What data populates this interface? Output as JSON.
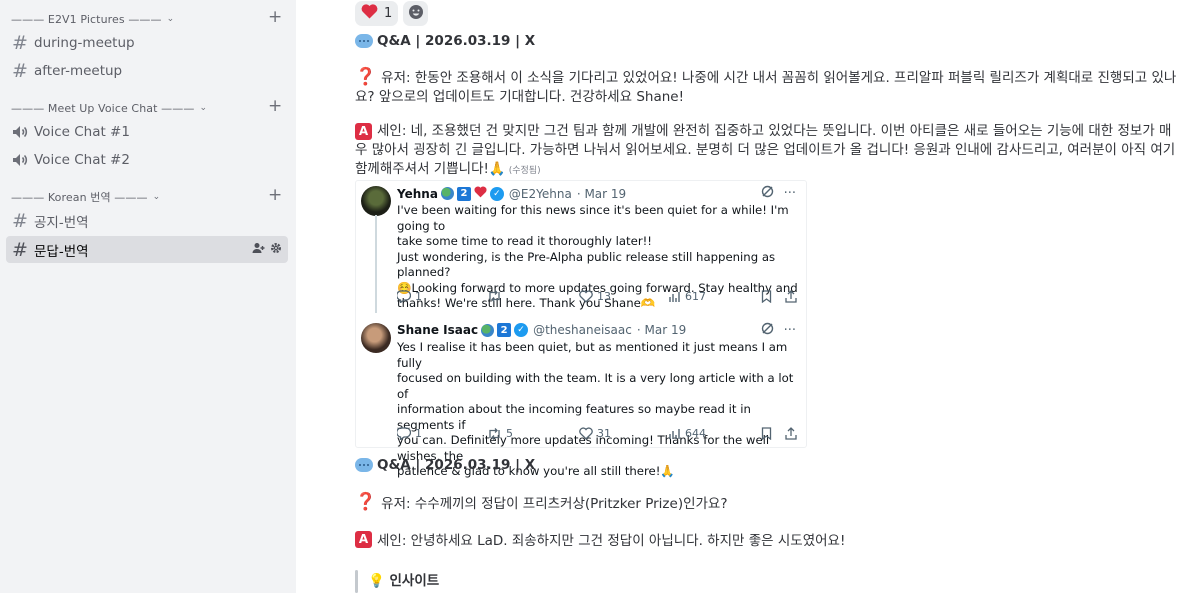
{
  "sidebar": {
    "categories": [
      {
        "label": "——— E2V1 Pictures ———"
      },
      {
        "label": "——— Meet Up Voice Chat ———"
      },
      {
        "label": "——— Korean 번역 ———"
      }
    ],
    "channels": [
      {
        "label": "during-meetup"
      },
      {
        "label": "after-meetup"
      },
      {
        "label": "Voice Chat #1"
      },
      {
        "label": "Voice Chat #2"
      },
      {
        "label": "공지-번역"
      },
      {
        "label": "문답-번역"
      }
    ]
  },
  "reactions": [
    {
      "emoji": "❤️",
      "count": "1"
    }
  ],
  "messages": [
    {
      "header": "Q&A | 2026.03.19 | X",
      "question": "유저: 한동안 조용해서 이 소식을 기다리고 있었어요! 나중에 시간 내서 꼼꼼히 읽어볼게요. 프리알파 퍼블릭 릴리즈가 계획대로 진행되고 있나요? 앞으로의 업데이트도 기대합니다. 건강하세요 Shane!",
      "answer": "세인: 네, 조용했던 건 맞지만 그건 팀과 함께 개발에 완전히 집중하고 있었다는 뜻입니다. 이번 아티클은 새로 들어오는 기능에 대한 정보가 매우 많아서 굉장히 긴 글입니다. 가능하면 나눠서 읽어보세요. 분명히 더 많은 업데이트가 올 겁니다! 응원과 인내에 감사드리고, 여러분이 아직 여기 함께해주셔서 기쁩니다!🙏",
      "edited": "(수정됨)"
    },
    {
      "header": "Q&A | 2026.03.19 | X",
      "question": "유저: 수수께끼의 정답이 프리츠커상(Pritzker Prize)인가요?",
      "answer": "세인: 안녕하세요 LaD. 죄송하지만 그건 정답이 아닙니다. 하지만 좋은 시도였어요!",
      "insight": "💡 인사이트"
    }
  ],
  "embed": {
    "tweets": [
      {
        "name": "Yehna",
        "badge": "2",
        "handle": "@E2Yehna",
        "date": "· Mar 19",
        "lines": [
          "I've been waiting for this news since it's been quiet for a while! I'm going to",
          "take some time to read it thoroughly later!!",
          "Just wondering, is the Pre-Alpha public release still happening as planned?",
          "☺️Looking forward to more updates going forward. Stay healthy and",
          "thanks! We're still here. Thank you Shane🫶"
        ],
        "replies": "1",
        "retweets": "",
        "likes": "13",
        "views": "617"
      },
      {
        "name": "Shane Isaac",
        "badge": "2",
        "handle": "@theshaneisaac",
        "date": "· Mar 19",
        "lines": [
          "Yes I realise it has been quiet, but as mentioned it just means I am fully",
          "focused on building with the team. It is a very long article with a lot of",
          "information about the incoming features so maybe read it in segments if",
          "you can. Definitely more updates incoming! Thanks for the well wishes, the",
          "patience & glad to know you're all still there!🙏"
        ],
        "replies": "1",
        "retweets": "5",
        "likes": "31",
        "views": "644"
      }
    ]
  },
  "colors": {
    "sidebar_bg": "#f2f3f5",
    "active_channel_bg": "#dcdde1",
    "question_red": "#dd2e44",
    "verified_blue": "#1d9bf0"
  }
}
